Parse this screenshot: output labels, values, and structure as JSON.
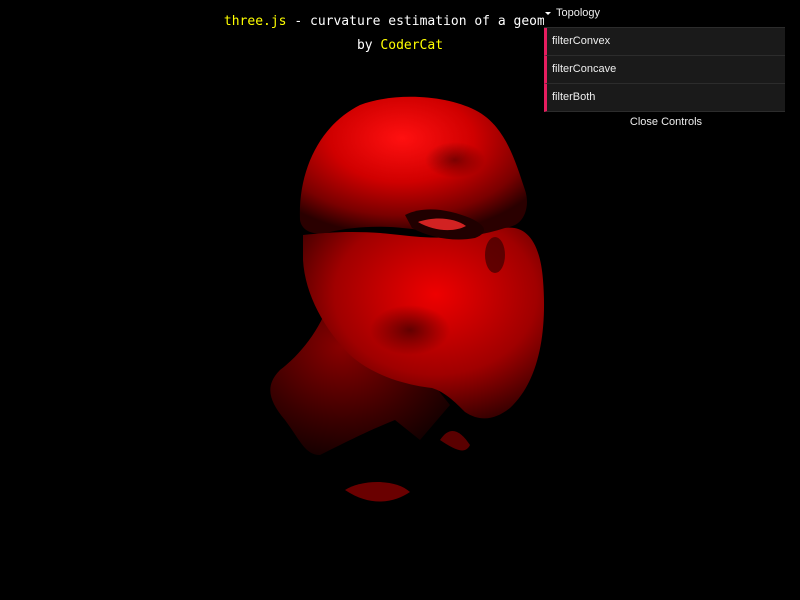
{
  "info": {
    "link_text": "three.js",
    "description": " - curvature estimation of a geometry",
    "by_text": "by ",
    "author": "CoderCat"
  },
  "gui": {
    "folder_title": "Topology",
    "items": [
      {
        "label": "filterConvex"
      },
      {
        "label": "filterConcave"
      },
      {
        "label": "filterBoth"
      }
    ],
    "close_label": "Close Controls"
  },
  "colors": {
    "background": "#000000",
    "link": "#ffff00",
    "accent": "#e61d5f",
    "mesh": "#ff0000"
  }
}
